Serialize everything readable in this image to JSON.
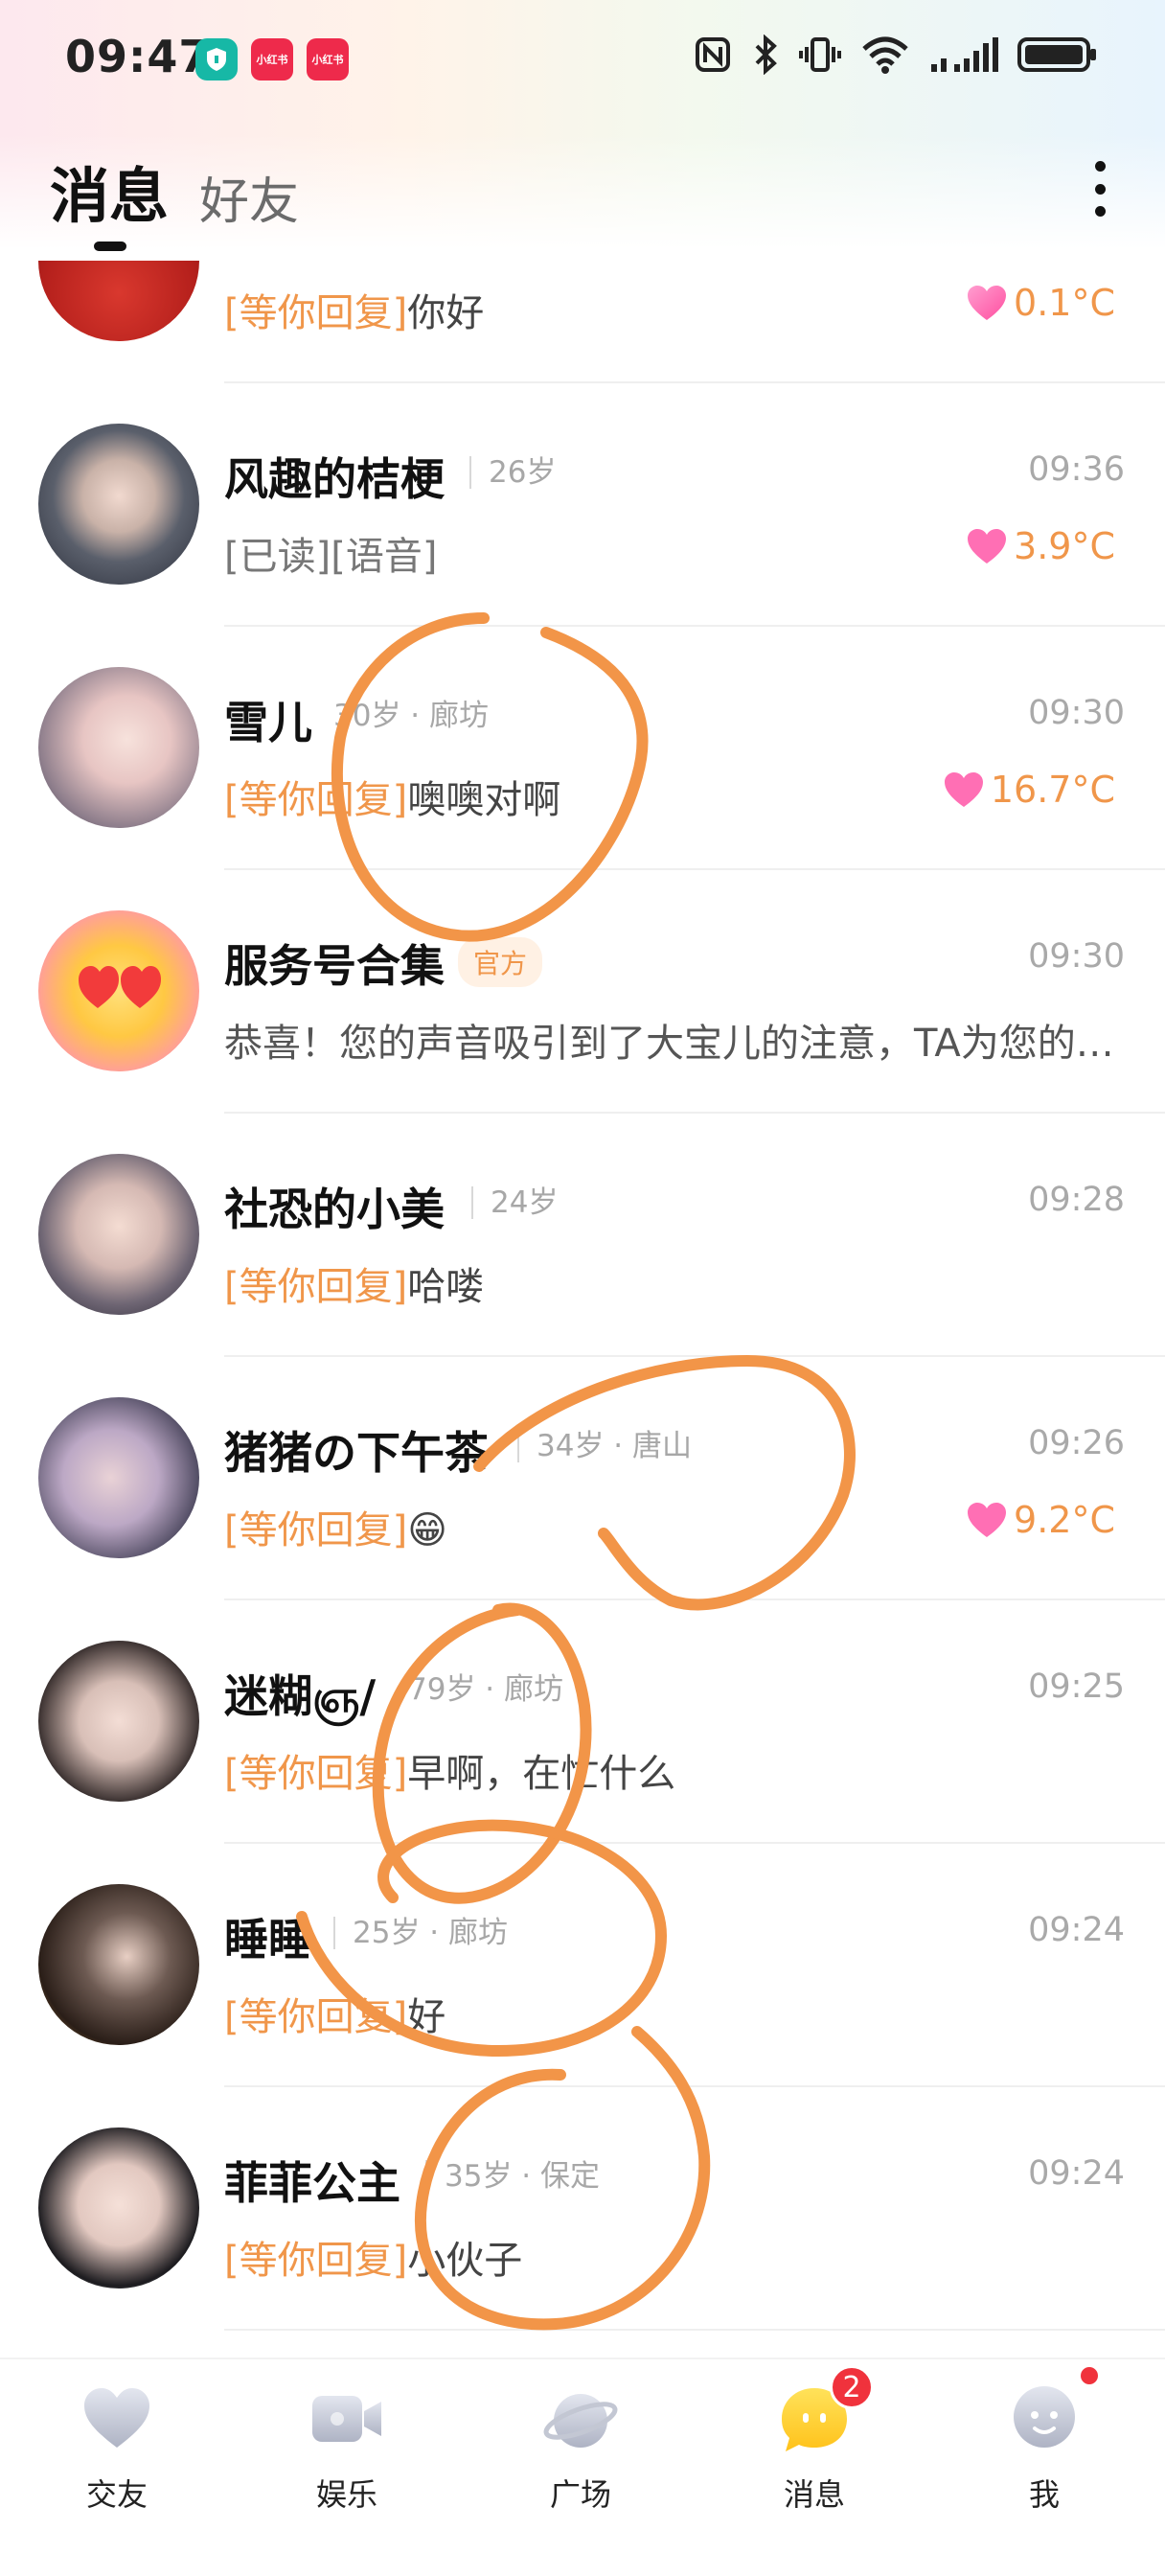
{
  "status_bar": {
    "time": "09:47",
    "notif_labels": [
      "小红书",
      "小红书"
    ]
  },
  "header": {
    "active_tab": "消息",
    "inactive_tab": "好友"
  },
  "conversations": [
    {
      "name": "",
      "meta": "",
      "time": "",
      "tag": "[等你回复]",
      "message": "你好",
      "temperature": "0.1°C"
    },
    {
      "name": "风趣的桔梗",
      "meta": "26岁",
      "time": "09:36",
      "tag": "",
      "read": "[已读]",
      "message": "[语音]",
      "temperature": "3.9°C"
    },
    {
      "name": "雪儿",
      "meta": "30岁 · 廊坊",
      "time": "09:30",
      "tag": "[等你回复]",
      "message": "噢噢对啊",
      "temperature": "16.7°C"
    },
    {
      "name": "服务号合集",
      "badge": "官方",
      "time": "09:30",
      "tag": "",
      "message": "恭喜！您的声音吸引到了大宝儿的注意，TA为您的语…",
      "temperature": ""
    },
    {
      "name": "社恐的小美",
      "meta": "24岁",
      "time": "09:28",
      "tag": "[等你回复]",
      "message": "哈喽",
      "temperature": ""
    },
    {
      "name": "猪猪の下午茶",
      "meta": "34岁 · 唐山",
      "time": "09:26",
      "tag": "[等你回复]",
      "message": "😁",
      "temperature": "9.2°C"
    },
    {
      "name": "迷糊ஞ/",
      "meta": "79岁 · 廊坊",
      "time": "09:25",
      "tag": "[等你回复]",
      "message": "早啊，在忙什么",
      "temperature": ""
    },
    {
      "name": "睡睡",
      "meta": "25岁 · 廊坊",
      "time": "09:24",
      "tag": "[等你回复]",
      "message": "好",
      "temperature": ""
    },
    {
      "name": "菲菲公主",
      "meta": "35岁 · 保定",
      "time": "09:24",
      "tag": "[等你回复]",
      "message": "小伙子",
      "temperature": ""
    }
  ],
  "bottom_nav": [
    {
      "label": "交友",
      "icon": "heart-icon"
    },
    {
      "label": "娱乐",
      "icon": "video-icon"
    },
    {
      "label": "广场",
      "icon": "planet-icon"
    },
    {
      "label": "消息",
      "icon": "chat-bubble-icon",
      "badge": "2"
    },
    {
      "label": "我",
      "icon": "profile-icon"
    }
  ],
  "colors": {
    "accent_orange": "#f0964a",
    "badge_red": "#f0323c",
    "scribble_orange": "#f29548"
  }
}
